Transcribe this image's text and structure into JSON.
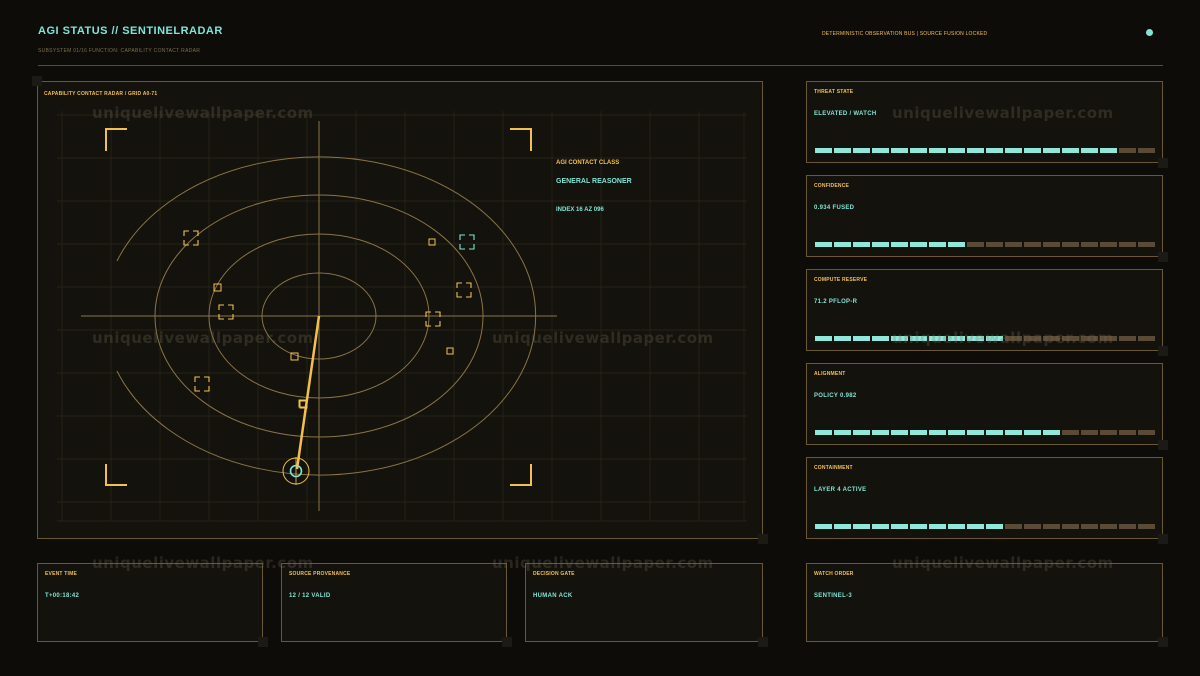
{
  "header": {
    "title": "AGI STATUS // SENTINELRADAR",
    "subtitle": "SUBSYSTEM 01/16    FUNCTION: CAPABILITY CONTACT RADAR",
    "bus": "DETERMINISTIC OBSERVATION BUS  |  SOURCE FUSION LOCKED"
  },
  "radar": {
    "label": "CAPABILITY CONTACT RADAR / GRID A0-71",
    "contact_class": "AGI CONTACT CLASS",
    "contact_type": "GENERAL REASONER",
    "contact_index": "INDEX 16  AZ 096"
  },
  "metrics": [
    {
      "label": "THREAT STATE",
      "value": "ELEVATED / WATCH",
      "level": 16,
      "total": 18
    },
    {
      "label": "CONFIDENCE",
      "value": "0.934 FUSED",
      "level": 8,
      "total": 18
    },
    {
      "label": "COMPUTE RESERVE",
      "value": "71.2 PFLOP-R",
      "level": 10,
      "total": 18
    },
    {
      "label": "ALIGNMENT",
      "value": "POLICY 0.982",
      "level": 13,
      "total": 18
    },
    {
      "label": "CONTAINMENT",
      "value": "LAYER 4 ACTIVE",
      "level": 10,
      "total": 18
    }
  ],
  "bottom": [
    {
      "label": "EVENT TIME",
      "value": "T+00:18:42"
    },
    {
      "label": "SOURCE PROVENANCE",
      "value": "12 / 12 VALID"
    },
    {
      "label": "DECISION GATE",
      "value": "HUMAN ACK"
    },
    {
      "label": "WATCH ORDER",
      "value": "SENTINEL-3"
    }
  ],
  "watermark": "uniquelivewallpaper.com",
  "colors": {
    "accent": "#f2c04e",
    "teal": "#7fe6d6",
    "border": "#6a5733",
    "background": "#0d0c09"
  }
}
